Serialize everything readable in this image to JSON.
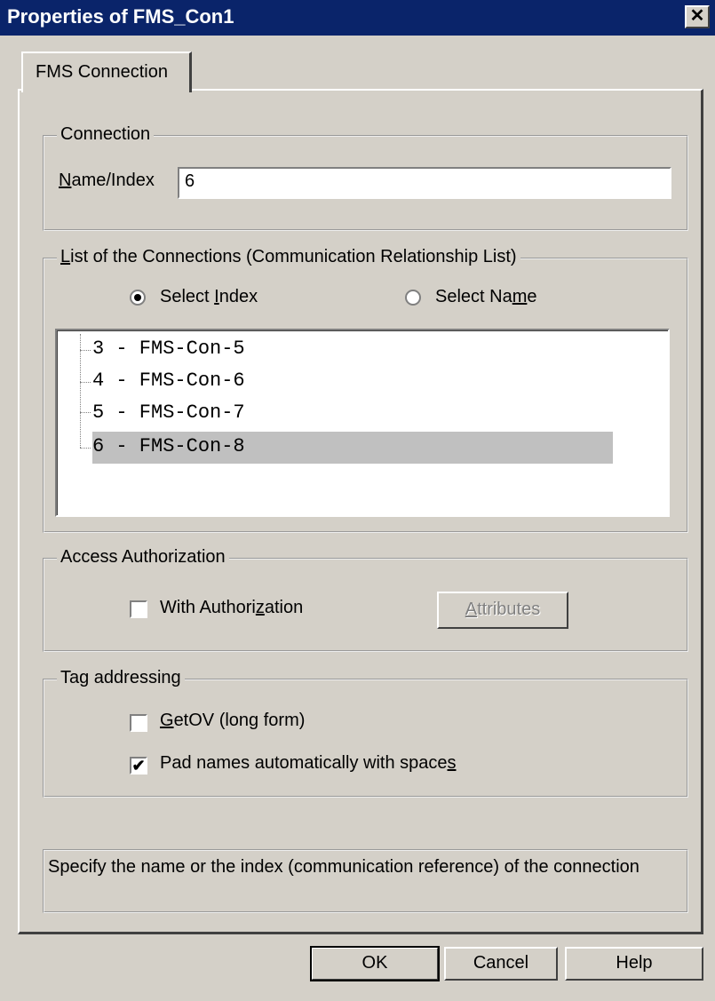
{
  "window": {
    "title": "Properties of FMS_Con1",
    "close_glyph": "✕"
  },
  "tab": {
    "label": "FMS Connection"
  },
  "connection": {
    "legend": "Connection",
    "name_label_u": "N",
    "name_label_rest": "ame/Index",
    "name_value": "6"
  },
  "list": {
    "legend_u": "L",
    "legend_rest": "ist of the Connections (Communication Relationship List)",
    "radio_index_pre": "Select ",
    "radio_index_u": "I",
    "radio_index_post": "ndex",
    "radio_name_pre": "Select Na",
    "radio_name_u": "m",
    "radio_name_post": "e",
    "selected_radio": "index",
    "items": [
      "3 - FMS-Con-5",
      "4 - FMS-Con-6",
      "5 - FMS-Con-7",
      "6 - FMS-Con-8"
    ],
    "selected_item": "6 - FMS-Con-8"
  },
  "access": {
    "legend": "Access Authorization",
    "checkbox_pre": "With Authori",
    "checkbox_u": "z",
    "checkbox_post": "ation",
    "checked": false,
    "attributes_u": "A",
    "attributes_rest": "ttributes"
  },
  "tags": {
    "legend": "Tag addressing",
    "getov_u": "G",
    "getov_rest": "etOV (long form)",
    "getov_checked": false,
    "pad_pre": "Pad names automatically with space",
    "pad_u": "s",
    "pad_checked": true
  },
  "description": "Specify the name or the index (communication reference) of the connection",
  "buttons": {
    "ok": "OK",
    "cancel": "Cancel",
    "help": "Help"
  },
  "icons": {
    "check_glyph": "✔"
  }
}
